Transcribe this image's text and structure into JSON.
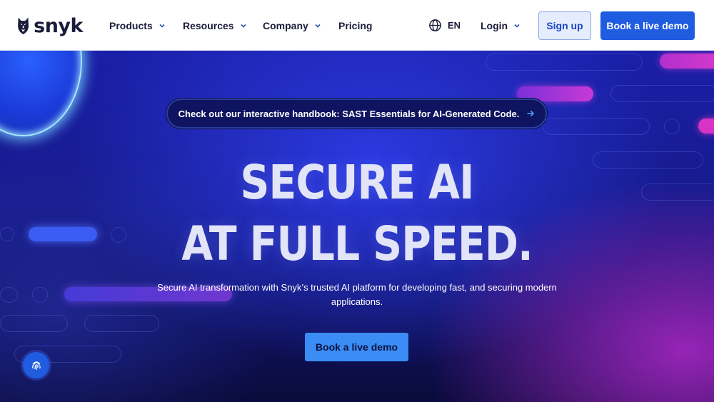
{
  "header": {
    "logo_text": "snyk",
    "nav": [
      {
        "label": "Products",
        "has_dropdown": true
      },
      {
        "label": "Resources",
        "has_dropdown": true
      },
      {
        "label": "Company",
        "has_dropdown": true
      },
      {
        "label": "Pricing",
        "has_dropdown": false
      }
    ],
    "language": "EN",
    "login_label": "Login",
    "signup_label": "Sign up",
    "demo_label": "Book a live demo"
  },
  "hero": {
    "announcement": "Check out our interactive handbook: SAST Essentials for AI-Generated Code.",
    "headline_line1": "SECURE AI",
    "headline_line2": "AT FULL SPEED.",
    "subtext": "Secure AI transformation with Snyk’s trusted AI platform for developing fast, and securing modern applications.",
    "cta_label": "Book a live demo"
  },
  "icons": {
    "language": "globe-icon",
    "dropdown": "chevron-down-icon",
    "announcement": "arrow-right-icon",
    "floating": "fingerprint-icon"
  },
  "colors": {
    "brand_blue": "#1f5ce0",
    "hero_cta": "#3b8cf5",
    "header_text": "#1b1c3a",
    "hero_bg": "#161a8a",
    "accent_magenta": "#c0289e"
  }
}
